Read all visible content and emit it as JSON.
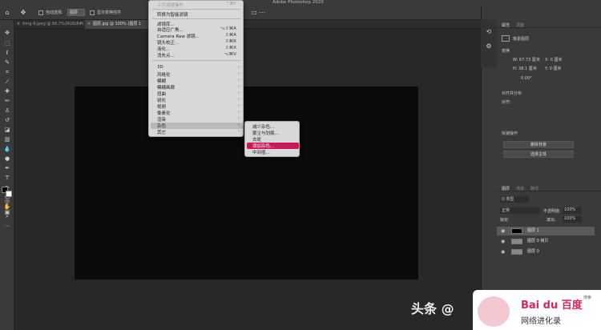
{
  "app": {
    "window_title": "Adobe Photoshop 2020"
  },
  "options_bar": {
    "auto_select_label": "自动选择:",
    "auto_select_value": "图层",
    "show_transform_label": "显示变换控件"
  },
  "tabs": [
    {
      "label": "timg-9.jpeg @ 66.7%(RGB/8#)"
    },
    {
      "label": "图层.jpg @ 100% (图层 1"
    }
  ],
  "filter_menu": {
    "last_filter": "上次滤镜操作",
    "last_filter_shortcut": "^⌘F",
    "convert_smart": "转换为智能滤镜",
    "items_a": [
      {
        "label": "滤镜库...",
        "shortcut": ""
      },
      {
        "label": "自适应广角...",
        "shortcut": "⌥⇧⌘A"
      },
      {
        "label": "Camera Raw 滤镜...",
        "shortcut": "⇧⌘A"
      },
      {
        "label": "镜头校正...",
        "shortcut": "⇧⌘R"
      },
      {
        "label": "液化...",
        "shortcut": "⇧⌘X"
      },
      {
        "label": "消失点...",
        "shortcut": "⌥⌘V"
      }
    ],
    "items_b": [
      {
        "label": "3D"
      },
      {
        "label": "风格化"
      },
      {
        "label": "模糊"
      },
      {
        "label": "模糊画廊"
      },
      {
        "label": "扭曲"
      },
      {
        "label": "锐化"
      },
      {
        "label": "视频"
      },
      {
        "label": "像素化"
      },
      {
        "label": "渲染"
      },
      {
        "label": "杂色"
      },
      {
        "label": "其它"
      }
    ]
  },
  "noise_submenu": {
    "items": [
      {
        "label": "减少杂色..."
      },
      {
        "label": "蒙尘与划痕..."
      },
      {
        "label": "去斑"
      },
      {
        "label": "添加杂色..."
      },
      {
        "label": "中间值..."
      }
    ],
    "selected_index": 3
  },
  "properties_panel": {
    "tabs": [
      "属性",
      "调整"
    ],
    "layer_type": "像素图层",
    "transform_title": "变换",
    "w": "W: 67.73 厘米",
    "x": "X: 0 厘米",
    "h": "H: 38.1 厘米",
    "y": "Y: 0 厘米",
    "angle": "0.00°",
    "align_title": "对齐并分布",
    "align_sub": "对齐:",
    "quick_actions_title": "快速操作",
    "btn_remove_bg": "删除背景",
    "btn_select_subject": "选择主体"
  },
  "layers_panel": {
    "tabs": [
      "图层",
      "通道",
      "路径"
    ],
    "filter_kind": "Q 类型",
    "blend_mode": "正常",
    "opacity_label": "不透明度:",
    "opacity_value": "100%",
    "lock_label": "锁定:",
    "fill_label": "填充:",
    "fill_value": "100%",
    "layers": [
      {
        "name": "图层 1"
      },
      {
        "name": "图层 0 拷贝"
      },
      {
        "name": "图层 0"
      }
    ]
  },
  "watermarks": {
    "toutiao": "头条 @",
    "baidu_logo": "Bai du 百度",
    "baidu_sub": "网络进化录",
    "search": "搜索"
  }
}
